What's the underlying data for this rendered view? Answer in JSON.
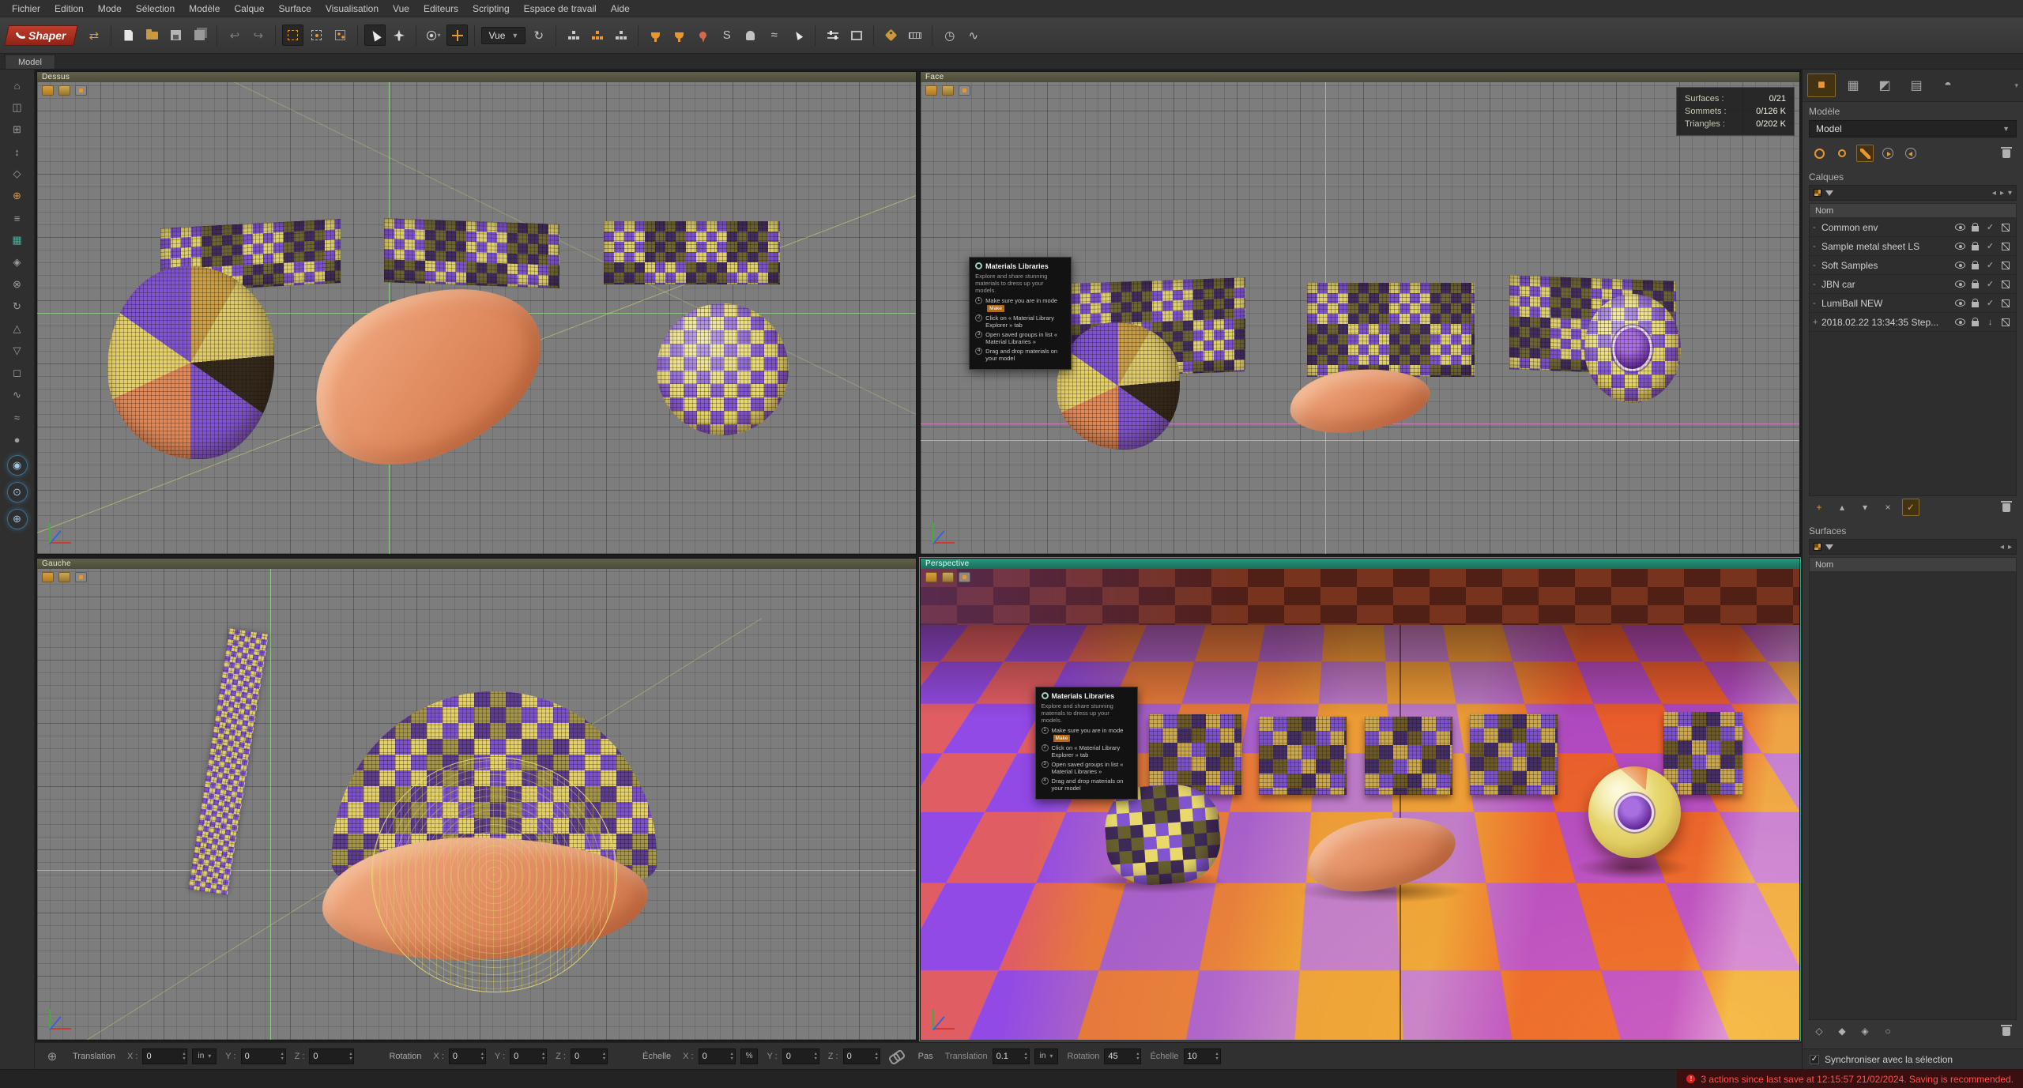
{
  "app": {
    "badge": "Shaper",
    "tab": "Model"
  },
  "menubar": {
    "items": [
      "Fichier",
      "Edition",
      "Mode",
      "Sélection",
      "Modèle",
      "Calque",
      "Surface",
      "Visualisation",
      "Vue",
      "Editeurs",
      "Scripting",
      "Espace de travail",
      "Aide"
    ]
  },
  "toolbar": {
    "view_dropdown": "Vue"
  },
  "viewports": {
    "top": {
      "label": "Dessus"
    },
    "front": {
      "label": "Face",
      "stats": [
        {
          "label": "Surfaces :",
          "value": "0/21"
        },
        {
          "label": "Sommets :",
          "value": "0/126 K"
        },
        {
          "label": "Triangles :",
          "value": "0/202 K"
        }
      ]
    },
    "left": {
      "label": "Gauche"
    },
    "perspective": {
      "label": "Perspective"
    }
  },
  "tooltip": {
    "title": "Materials Libraries",
    "description": "Explore and share stunning materials to dress up your models.",
    "steps": [
      {
        "text": "Make sure you are in mode",
        "chip": "Make"
      },
      {
        "text": "Click on « Material Library Explorer » tab"
      },
      {
        "text": "Open saved groups in list « Material Libraries »"
      },
      {
        "text": "Drag and drop materials on your model"
      }
    ]
  },
  "right_panel": {
    "model_section": {
      "title": "Modèle",
      "dropdown": "Model"
    },
    "layers_section": {
      "title": "Calques",
      "name_header": "Nom",
      "layers": [
        {
          "prefix": "-",
          "name": "Common env",
          "moved": false
        },
        {
          "prefix": "-",
          "name": "Sample metal sheet LS",
          "moved": false
        },
        {
          "prefix": "-",
          "name": "Soft Samples",
          "moved": false
        },
        {
          "prefix": "-",
          "name": "JBN car",
          "moved": false
        },
        {
          "prefix": "-",
          "name": "LumiBall NEW",
          "moved": false
        },
        {
          "prefix": "+",
          "name": "2018.02.22 13:34:35 Step...",
          "moved": true
        }
      ]
    },
    "surfaces_section": {
      "title": "Surfaces",
      "name_header": "Nom"
    },
    "sync_label": "Synchroniser avec la sélection"
  },
  "bottom_bar": {
    "axis": {
      "x": "X :",
      "y": "Y :",
      "z": "Z :"
    },
    "translation": {
      "label": "Translation",
      "x": "0",
      "y": "0",
      "z": "0",
      "unit": "in"
    },
    "rotation": {
      "label": "Rotation",
      "x": "0",
      "y": "0",
      "z": "0"
    },
    "scale": {
      "label": "Échelle",
      "x": "0",
      "y": "0",
      "z": "0",
      "unit": "%"
    },
    "steps": {
      "label": "Pas",
      "t_label": "Translation",
      "t_value": "0.1",
      "t_unit": "in",
      "r_label": "Rotation",
      "r_value": "45",
      "s_label": "Échelle",
      "s_value": "10"
    }
  },
  "status": {
    "warning": "3 actions since last save at 12:15:57 21/02/2024. Saving is recommended."
  },
  "colors": {
    "accent": "#e8962e",
    "active_viewport": "#1f8a70",
    "warning": "#ff5252"
  },
  "icons": [
    "shaper-logo",
    "swap-icon",
    "new-file-icon",
    "open-folder-icon",
    "save-icon",
    "save-all-icon",
    "undo-icon",
    "redo-icon",
    "marquee-select-icon",
    "lasso-select-icon",
    "paint-select-icon",
    "cursor-tool-icon",
    "jet-tool-icon",
    "spray-tool-icon",
    "move-gizmo-icon",
    "orbit-view-icon",
    "hierarchy-icon",
    "trophy-icon",
    "pin-icon",
    "wave-icon",
    "sliders-icon",
    "frame-icon",
    "tag-icon",
    "ruler-icon",
    "timer-icon",
    "curve-icon",
    "eye-icon",
    "lock-icon",
    "check-icon",
    "funnel-icon",
    "trash-icon",
    "gear-icon"
  ]
}
